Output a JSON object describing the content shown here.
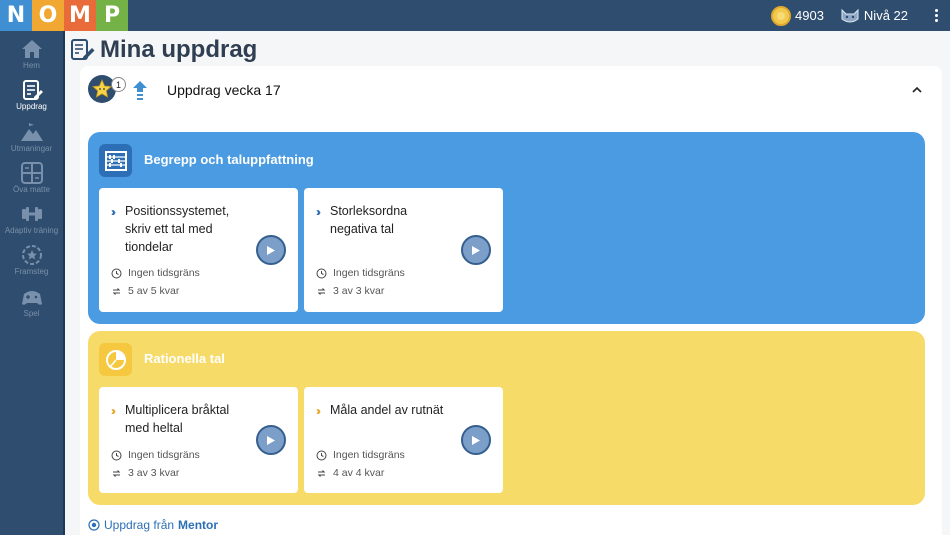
{
  "logo": {
    "letters": [
      {
        "char": "N",
        "color": "#3f8fd2"
      },
      {
        "char": "O",
        "color": "#f0a832"
      },
      {
        "char": "M",
        "color": "#e96b3a"
      },
      {
        "char": "P",
        "color": "#74b247"
      }
    ]
  },
  "topbar": {
    "coins": "4903",
    "coin_icon": "coin-icon",
    "level": "Nivå 22",
    "level_icon": "cat-avatar-icon"
  },
  "sidebar": {
    "items": [
      {
        "label": "Hem",
        "icon": "home-icon",
        "active": false
      },
      {
        "label": "Uppdrag",
        "icon": "assignment-icon",
        "active": true
      },
      {
        "label": "Utmaningar",
        "icon": "mountain-icon",
        "active": false
      },
      {
        "label": "Öva matte",
        "icon": "calculator-icon",
        "active": false
      },
      {
        "label": "Adaptiv träning",
        "icon": "dumbbell-icon",
        "active": false
      },
      {
        "label": "Framsteg",
        "icon": "progress-star-icon",
        "active": false
      },
      {
        "label": "Spel",
        "icon": "game-icon",
        "active": false
      }
    ]
  },
  "page": {
    "title": "Mina uppdrag"
  },
  "week": {
    "title": "Uppdrag vecka 17",
    "badge_count": "1"
  },
  "categories": [
    {
      "title": "Begrepp och taluppfattning",
      "color": "#4a9be1",
      "cards": [
        {
          "title": "Positionssystemet, skriv ett tal med tiondelar",
          "time": "Ingen tidsgräns",
          "remaining": "5 av 5 kvar"
        },
        {
          "title": "Storleksordna negativa tal",
          "time": "Ingen tidsgräns",
          "remaining": "3 av 3 kvar"
        }
      ]
    },
    {
      "title": "Rationella tal",
      "color": "#f7db68",
      "cards": [
        {
          "title": "Multiplicera bråktal med heltal",
          "time": "Ingen tidsgräns",
          "remaining": "3 av 3 kvar"
        },
        {
          "title": "Måla andel av rutnät",
          "time": "Ingen tidsgräns",
          "remaining": "4 av 4 kvar"
        }
      ]
    }
  ],
  "mentor": {
    "prefix": "Uppdrag från",
    "name": "Mentor"
  }
}
